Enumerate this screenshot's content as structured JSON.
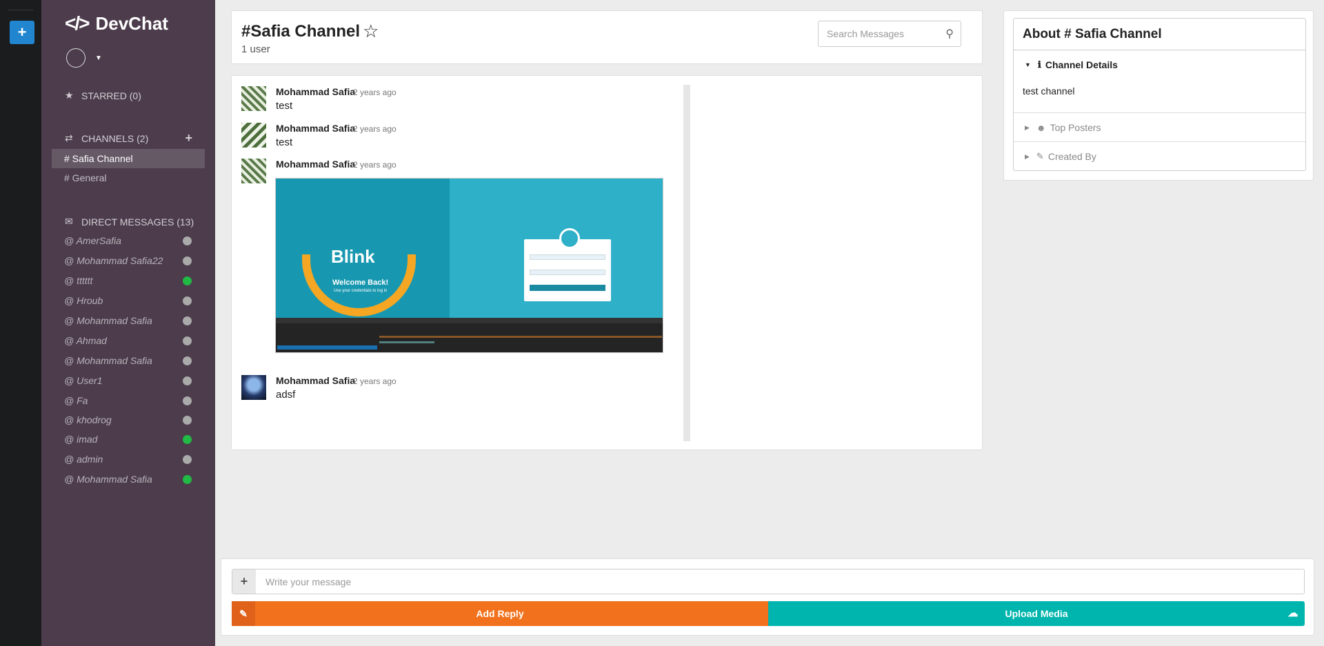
{
  "app": {
    "brand": "DevChat",
    "brand_icon": "code-icon"
  },
  "sidebar": {
    "starred_label": "STARRED (0)",
    "channels_label": "CHANNELS (2)",
    "channels": [
      {
        "label": "# Safia Channel",
        "active": true
      },
      {
        "label": "# General",
        "active": false
      }
    ],
    "dm_label": "DIRECT MESSAGES (13)",
    "dms": [
      {
        "label": "@ AmerSafia",
        "online": false
      },
      {
        "label": "@ Mohammad Safia22",
        "online": false
      },
      {
        "label": "@ tttttt",
        "online": true
      },
      {
        "label": "@ Hroub",
        "online": false
      },
      {
        "label": "@ Mohammad Safia",
        "online": false
      },
      {
        "label": "@ Ahmad",
        "online": false
      },
      {
        "label": "@ Mohammad Safia",
        "online": false
      },
      {
        "label": "@ User1",
        "online": false
      },
      {
        "label": "@ Fa",
        "online": false
      },
      {
        "label": "@ khodrog",
        "online": false
      },
      {
        "label": "@ imad",
        "online": true
      },
      {
        "label": "@ admin",
        "online": false
      },
      {
        "label": "@ Mohammad Safia",
        "online": true
      }
    ]
  },
  "header": {
    "title": "#Safia Channel",
    "users": "1 user",
    "search_placeholder": "Search Messages"
  },
  "messages": [
    {
      "author": "Mohammad Safia",
      "time": "2 years ago",
      "text": "test"
    },
    {
      "author": "Mohammad Safia",
      "time": "2 years ago",
      "text": "test"
    },
    {
      "author": "Mohammad Safia",
      "time": "2 years ago",
      "text": ""
    },
    {
      "author": "Mohammad Safia",
      "time": "2 years ago",
      "text": "adsf"
    }
  ],
  "shared_image": {
    "logo": "Blink",
    "welcome": "Welcome Back!",
    "subtitle": "Use your credentials to log in"
  },
  "about": {
    "title": "About # Safia Channel",
    "details_label": "Channel Details",
    "details_text": "test channel",
    "top_posters_label": "Top Posters",
    "created_by_label": "Created By"
  },
  "composer": {
    "placeholder": "Write your message",
    "reply_label": "Add Reply",
    "upload_label": "Upload Media"
  },
  "colors": {
    "sidebar_bg": "#4c3c4c",
    "rail_bg": "#1b1c1d",
    "accent_blue": "#2185d0",
    "reply_orange": "#f2711c",
    "upload_teal": "#00b5ad",
    "online_green": "#21ba45"
  }
}
